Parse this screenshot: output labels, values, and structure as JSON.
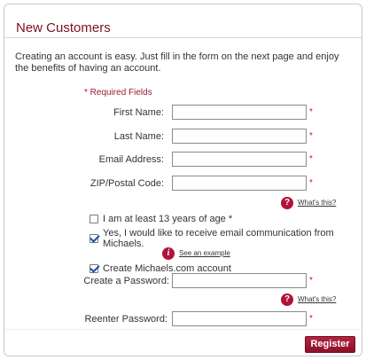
{
  "header": {
    "title": "New Customers"
  },
  "intro": {
    "text": "Creating an account is easy. Just fill in the form on the next page and enjoy the benefits of having an account."
  },
  "required_note": "* Required Fields",
  "fields": {
    "first_name": {
      "label": "First Name:",
      "value": "",
      "required": "*"
    },
    "last_name": {
      "label": "Last Name:",
      "value": "",
      "required": "*"
    },
    "email": {
      "label": "Email Address:",
      "value": "",
      "required": "*"
    },
    "zip": {
      "label": "ZIP/Postal Code:",
      "value": "",
      "required": "*"
    },
    "password": {
      "label": "Create a Password:",
      "value": "",
      "required": "*"
    },
    "reenter_password": {
      "label": "Reenter Password:",
      "value": "",
      "required": "*"
    }
  },
  "help": {
    "whats_this_1": "What's this?",
    "whats_this_2": "What's this?",
    "see_example": "See an example",
    "help_glyph": "?",
    "info_glyph": "i"
  },
  "checkboxes": {
    "age": {
      "label": "I am at least 13 years of age *",
      "checked": false
    },
    "email_opt_in": {
      "label": "Yes, I would like to receive email communication from Michaels.",
      "checked": true
    },
    "create_account": {
      "label": "Create Michaels.com account",
      "checked": true
    }
  },
  "actions": {
    "register": "Register"
  },
  "colors": {
    "brand": "#7a0f25",
    "accent": "#b3123a",
    "required": "#c0152f"
  },
  "icons": {
    "help": "help-question-icon",
    "info": "info-icon",
    "check": "checkmark-icon"
  }
}
